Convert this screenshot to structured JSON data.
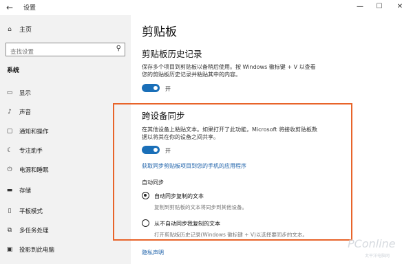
{
  "window": {
    "title": "设置",
    "controls": {
      "minimize": "—",
      "maximize": "☐",
      "close": "✕"
    }
  },
  "sidebar": {
    "home_label": "主页",
    "search_placeholder": "查找设置",
    "section": "系统",
    "items": [
      {
        "label": "显示",
        "icon": "display-icon"
      },
      {
        "label": "声音",
        "icon": "sound-icon"
      },
      {
        "label": "通知和操作",
        "icon": "notification-icon"
      },
      {
        "label": "专注助手",
        "icon": "focus-assist-icon"
      },
      {
        "label": "电源和睡眠",
        "icon": "power-icon"
      },
      {
        "label": "存储",
        "icon": "storage-icon"
      },
      {
        "label": "平板模式",
        "icon": "tablet-mode-icon"
      },
      {
        "label": "多任务处理",
        "icon": "multitasking-icon"
      },
      {
        "label": "投影到此电脑",
        "icon": "project-icon"
      }
    ]
  },
  "main": {
    "page_title": "剪贴板",
    "history": {
      "heading": "剪贴板历史记录",
      "description_line1": "保存多个项目到剪贴板以备稍后使用。按 Windows 徽标键 + V 以查看",
      "description_line2": "您的剪贴板历史记录并粘贴其中的内容。",
      "toggle_state": "开"
    },
    "sync": {
      "heading": "跨设备同步",
      "description_line1": "在其他设备上粘贴文本。如果打开了此功能，Microsoft 将接收剪贴板数",
      "description_line2": "据以将其在你的设备之间共享。",
      "toggle_state": "开",
      "link": "获取同步剪贴板项目到您的手机的应用程序",
      "auto_sync_label": "自动同步",
      "option1_label": "自动同步复制的文本",
      "option1_desc": "复制到剪贴板的文本将同步到其他设备。",
      "option2_label": "从不自动同步我复制的文本",
      "option2_desc": "打开剪贴板历史记录(Windows 徽标键 + V)以选择要同步的文本。"
    },
    "privacy_link": "隐私声明"
  },
  "watermark": {
    "brand": "PConline",
    "sub": "太平洋电脑网"
  }
}
